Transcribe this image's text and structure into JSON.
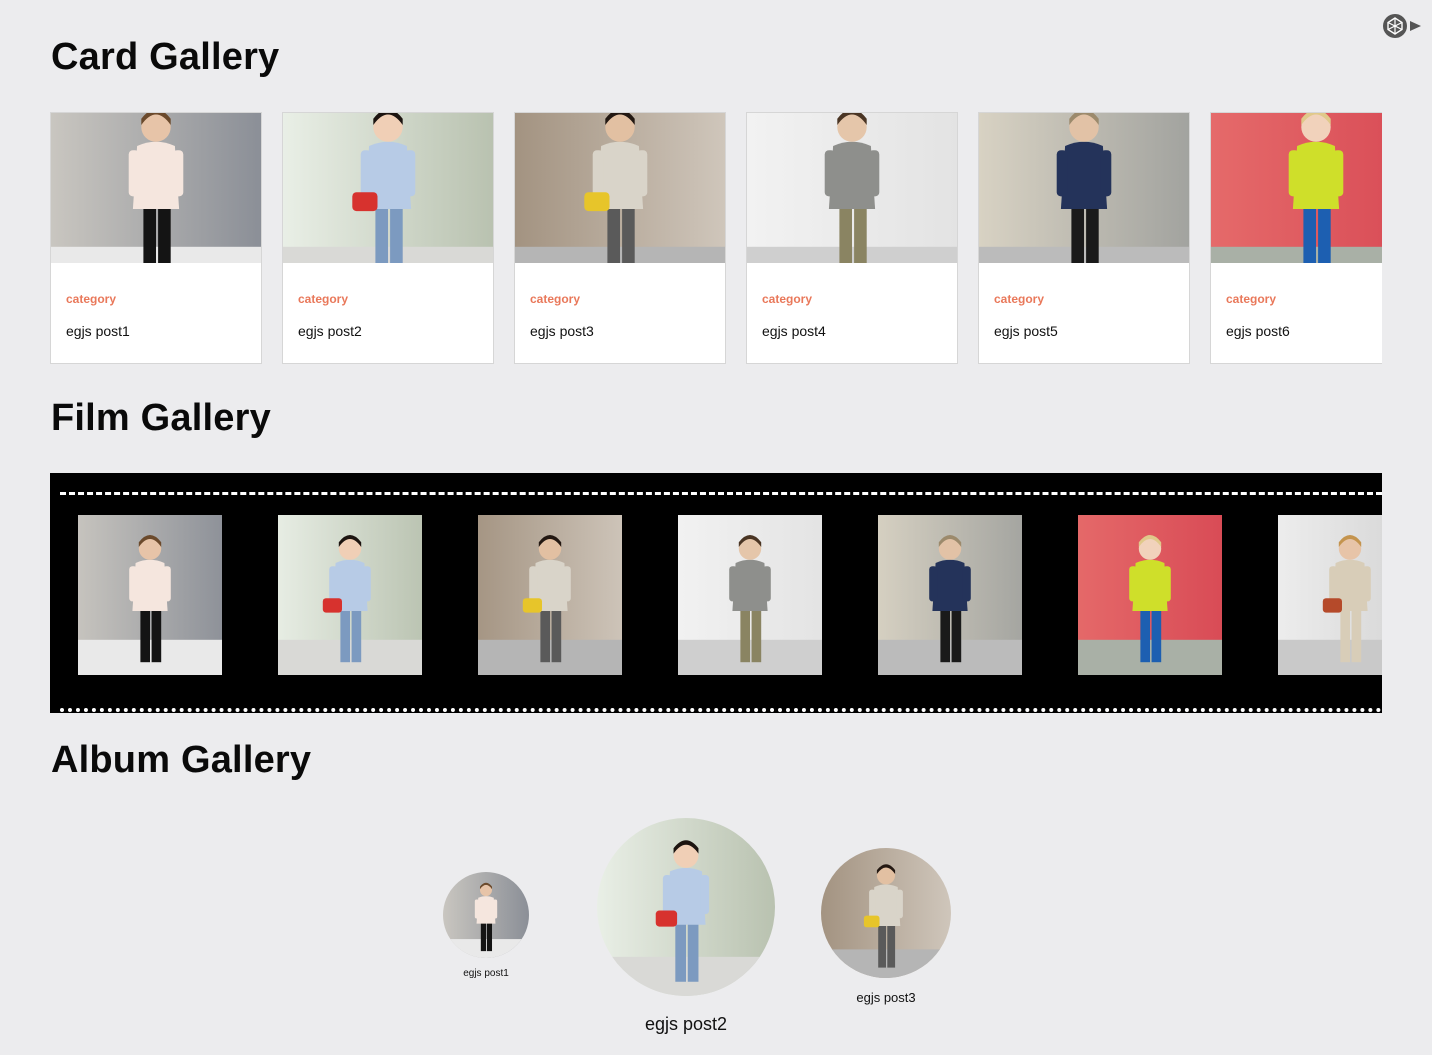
{
  "sections": {
    "card": "Card Gallery",
    "film": "Film Gallery",
    "album": "Album Gallery"
  },
  "cards": [
    {
      "category": "category",
      "title": "egjs post1",
      "photo": "woman-white-blouse-black-pants"
    },
    {
      "category": "category",
      "title": "egjs post2",
      "photo": "woman-blue-shirt-red-bag"
    },
    {
      "category": "category",
      "title": "egjs post3",
      "photo": "woman-houndstooth-pants"
    },
    {
      "category": "category",
      "title": "egjs post4",
      "photo": "man-gray-cardigan-khakis"
    },
    {
      "category": "category",
      "title": "egjs post5",
      "photo": "man-navy-jacket-black-jeans"
    },
    {
      "category": "category",
      "title": "egjs post6",
      "photo": "woman-yellow-top-blue-skirt"
    }
  ],
  "film_frames": [
    "woman-white-blouse-black-pants",
    "woman-blue-shirt-red-bag",
    "woman-houndstooth-pants",
    "man-gray-cardigan-khakis",
    "man-navy-jacket-black-jeans",
    "woman-yellow-top-blue-skirt",
    "woman-patterned-dress"
  ],
  "albums": [
    {
      "title": "egjs post1",
      "photo": "woman-white-blouse-black-pants"
    },
    {
      "title": "egjs post2",
      "photo": "woman-blue-shirt-red-bag"
    },
    {
      "title": "egjs post3",
      "photo": "woman-houndstooth-pants"
    }
  ],
  "icons": {
    "top_right": "codepen-icon"
  },
  "colors": {
    "page_bg": "#ececee",
    "category": "#e9785a",
    "film_bg": "#000000"
  }
}
